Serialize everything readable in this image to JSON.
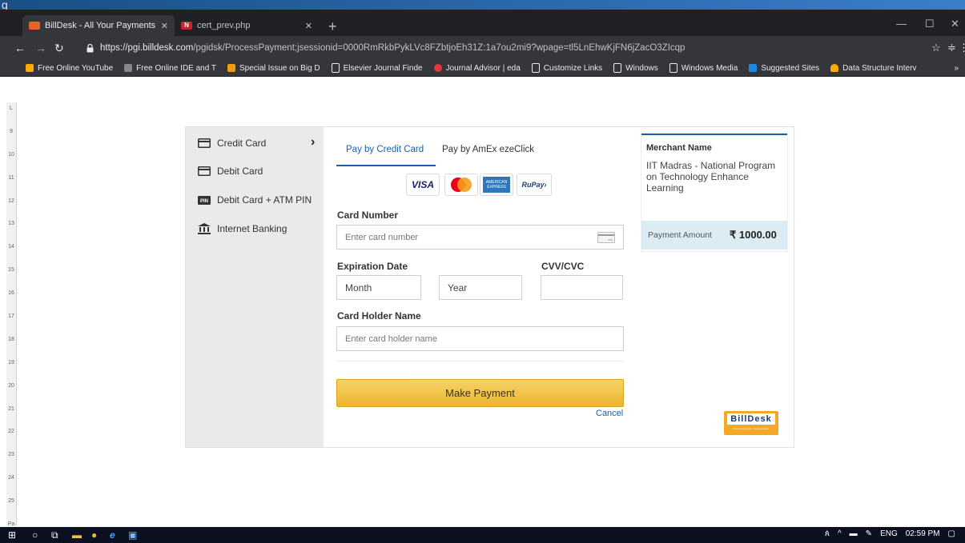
{
  "browser": {
    "tabs": [
      {
        "title": "BillDesk - All Your Payments. Sing",
        "favicon_color": "#e8622c"
      },
      {
        "title": "cert_prev.php",
        "favicon_color": "#c1272d",
        "favicon_letter": "N"
      }
    ],
    "url_scheme": "https://",
    "url_host": "pgi.billdesk.com",
    "url_path": "/pgidsk/ProcessPayment;jsessionid=0000RmRkbPykLVc8FZbtjoEh31Z:1a7ou2mi9?wpage=tl5LnEhwKjFN6jZacO3ZIcqp",
    "bookmarks": [
      {
        "label": "Free Online YouTube",
        "icon": "download-icon",
        "color": "#f9ab00"
      },
      {
        "label": "Free Online IDE and T",
        "icon": "ide-icon",
        "color": "#888888"
      },
      {
        "label": "Special Issue on Big D",
        "icon": "journal-icon",
        "color": "#f29c11"
      },
      {
        "label": "Elsevier Journal Finde",
        "icon": "page-icon",
        "color": "#ffffff"
      },
      {
        "label": "Journal Advisor | eda",
        "icon": "advisor-icon",
        "color": "#e53935"
      },
      {
        "label": "Customize Links",
        "icon": "page-icon",
        "color": "#ffffff"
      },
      {
        "label": "Windows",
        "icon": "page-icon",
        "color": "#ffffff"
      },
      {
        "label": "Windows Media",
        "icon": "page-icon",
        "color": "#ffffff"
      },
      {
        "label": "Suggested Sites",
        "icon": "bing-icon",
        "color": "#1e88e5"
      },
      {
        "label": "Data Structure Interv",
        "icon": "trophy-icon",
        "color": "#f9ab00"
      }
    ],
    "more_glyph": "»"
  },
  "ruler": [
    "L",
    "9",
    "10",
    "11",
    "12",
    "13",
    "14",
    "15",
    "16",
    "17",
    "18",
    "19",
    "20",
    "21",
    "22",
    "23",
    "24",
    "25",
    "Pa"
  ],
  "payment_methods": [
    {
      "label": "Credit Card",
      "icon": "credit-card-icon"
    },
    {
      "label": "Debit Card",
      "icon": "debit-card-icon"
    },
    {
      "label": "Debit Card + ATM PIN",
      "icon": "pin-icon"
    },
    {
      "label": "Internet Banking",
      "icon": "bank-icon"
    }
  ],
  "active_chevron": "›",
  "pay_tabs": {
    "credit": "Pay by Credit Card",
    "amex": "Pay by AmEx ezeClick"
  },
  "card_logos": {
    "visa": "VISA",
    "amex_top": "AMERICAN",
    "amex_bottom": "EXPRESS",
    "rupay": "RuPay›"
  },
  "form": {
    "card_number_label": "Card Number",
    "card_number_placeholder": "Enter card number",
    "expiry_label": "Expiration Date",
    "month_placeholder": "Month",
    "year_placeholder": "Year",
    "cvv_label": "CVV/CVC",
    "holder_label": "Card Holder Name",
    "holder_placeholder": "Enter card holder name",
    "submit": "Make Payment",
    "cancel": "Cancel"
  },
  "merchant": {
    "label": "Merchant Name",
    "name": "IIT Madras - National Program on Technology Enhance Learning",
    "amount_label": "Payment Amount",
    "amount": "₹ 1000.00"
  },
  "billdesk": {
    "logo": "BillDesk",
    "tagline": "All your payments. Single location."
  },
  "taskbar": {
    "language": "ENG",
    "time": "02:59 PM"
  },
  "colors": {
    "accent": "#1a5fa7",
    "button": "#f2c14e",
    "billdesk": "#f7a823"
  }
}
